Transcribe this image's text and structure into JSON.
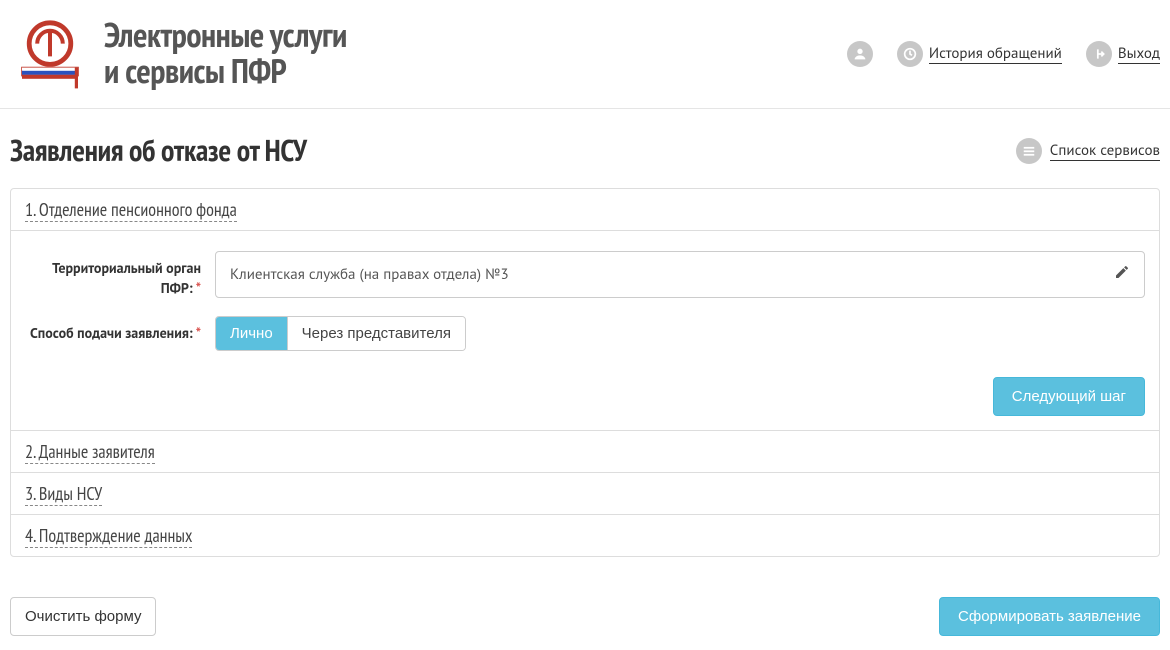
{
  "header": {
    "brand_line1": "Электронные услуги",
    "brand_line2": "и сервисы ПФР",
    "history_label": "История обращений",
    "logout_label": "Выход"
  },
  "page": {
    "title": "Заявления об отказе от НСУ",
    "services_list_label": "Список сервисов"
  },
  "steps": [
    {
      "label": "1. Отделение пенсионного фонда"
    },
    {
      "label": "2. Данные заявителя"
    },
    {
      "label": "3. Виды НСУ"
    },
    {
      "label": "4. Подтверждение данных"
    }
  ],
  "form": {
    "territorial_label": "Территориальный орган ПФР:",
    "territorial_value": "Клиентская служба (на правах отдела) №3",
    "submission_method_label": "Способ подачи заявления:",
    "method_options": {
      "personal": "Лично",
      "representative": "Через представителя"
    },
    "next_button": "Следующий шаг"
  },
  "footer": {
    "clear_button": "Очистить форму",
    "submit_button": "Сформировать заявление"
  }
}
